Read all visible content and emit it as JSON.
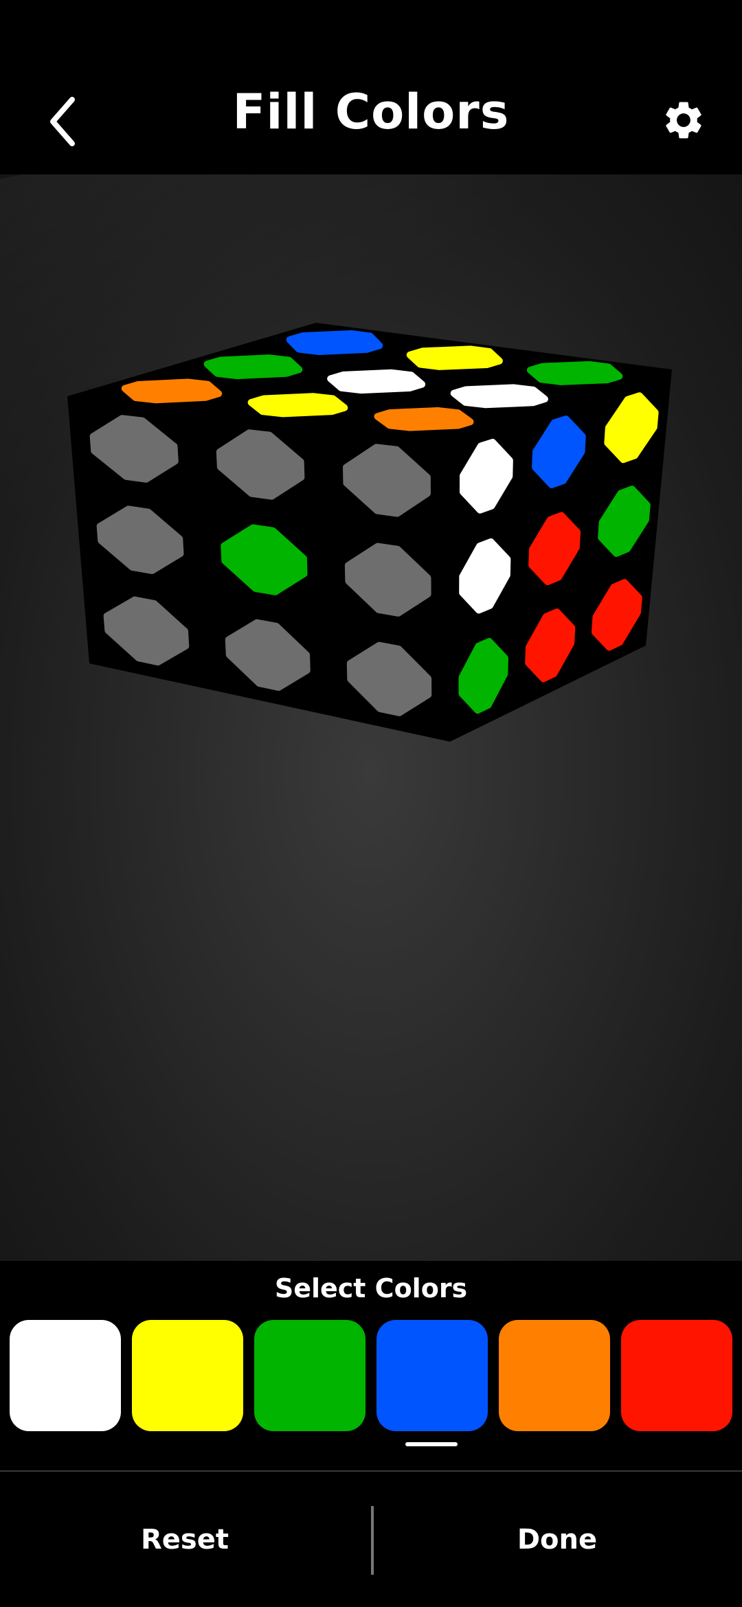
{
  "header": {
    "title": "Fill Colors",
    "back_icon": "chevron-left-icon",
    "settings_icon": "gear-icon"
  },
  "cube": {
    "top_face": [
      [
        "orange",
        "green",
        "blue"
      ],
      [
        "yellow",
        "white",
        "yellow"
      ],
      [
        "orange",
        "white",
        "green"
      ]
    ],
    "front_face": [
      [
        "gray",
        "gray",
        "gray"
      ],
      [
        "gray",
        "green",
        "gray"
      ],
      [
        "gray",
        "gray",
        "gray"
      ]
    ],
    "right_face": [
      [
        "white",
        "blue",
        "yellow"
      ],
      [
        "white",
        "red",
        "green"
      ],
      [
        "green",
        "red",
        "red"
      ]
    ]
  },
  "colors": {
    "white": "#ffffff",
    "yellow": "#ffff00",
    "green": "#00b400",
    "blue": "#0055ff",
    "orange": "#ff8000",
    "red": "#ff1400",
    "gray": "#6e6e6e",
    "plastic": "#000000"
  },
  "palette": {
    "title": "Select Colors",
    "swatches": [
      {
        "name": "white",
        "color": "#ffffff"
      },
      {
        "name": "yellow",
        "color": "#ffff00"
      },
      {
        "name": "green",
        "color": "#00b400"
      },
      {
        "name": "blue",
        "color": "#0055ff"
      },
      {
        "name": "orange",
        "color": "#ff8000"
      },
      {
        "name": "red",
        "color": "#ff1400"
      }
    ],
    "selected": "blue"
  },
  "footer": {
    "reset_label": "Reset",
    "done_label": "Done"
  }
}
